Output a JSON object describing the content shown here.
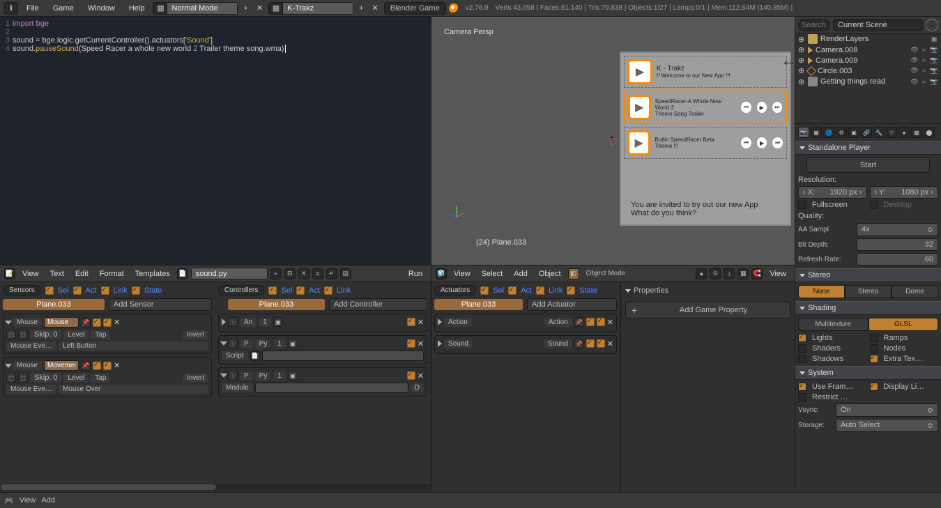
{
  "topbar": {
    "menus": [
      "File",
      "Game",
      "Window",
      "Help"
    ],
    "layout1": {
      "name": "Normal Mode"
    },
    "layout2": {
      "name": "K-Trakz"
    },
    "engine": "Blender Game",
    "version": "v2.76.9",
    "stats": "Verts:43,658 | Faces:61,140 | Tris:79,838 | Objects:1/27 | Lamps:0/1 | Mem:112.64M (140.85M) |"
  },
  "code": {
    "l1": "import bge",
    "l2": "",
    "l3a": "sound = bge.logic.getCurrentController().actuators[",
    "l3b": "'Sound'",
    "l3c": "]",
    "l4": "sound.pauseSound(Speed Racer a whole new world 2 Trailer theme song.wma)"
  },
  "text_header": {
    "menus": [
      "View",
      "Text",
      "Edit",
      "Format",
      "Templates"
    ],
    "filename": "sound.py",
    "run": "Run"
  },
  "viewport": {
    "label": "Camera Persp",
    "object": "(24) Plane.033",
    "phone": {
      "title": "K - Trakz",
      "welcome": "!! Welcome to our New App !!!",
      "row2_t": "SpeedRacer-A Whole New World 2",
      "row2_s": "Theme Song Trailer",
      "row3_t": "Butlin   SpeedRacer Beta Theme !!!",
      "footer1": "You are invited to try out our new App",
      "footer2": "What do you think?"
    }
  },
  "view3d_header": {
    "menus": [
      "View",
      "Select",
      "Add",
      "Object"
    ],
    "mode": "Object Mode"
  },
  "logic": {
    "sensors_hdr": "Sensors",
    "controllers_hdr": "Controllers",
    "actuators_hdr": "Actuators",
    "sel": "Sel",
    "act": "Act",
    "link": "Link",
    "state": "State",
    "object": "Plane.033",
    "add_sensor": "Add Sensor",
    "add_controller": "Add Controller",
    "add_actuator": "Add Actuator",
    "mouse_kind": "Mouse",
    "mouse_name1": "Mouse",
    "mouse_name2": "Movement",
    "skip_lbl": "Skip:",
    "skip_val": "0",
    "level": "Level",
    "tap": "Tap",
    "invert": "Invert",
    "mouse_event_lbl": "Mouse Eve…",
    "left_button": "Left Button",
    "mouse_over": "Mouse Over",
    "and_kind": "An",
    "py_kind": "Py",
    "one": "1",
    "script_lbl": "Script",
    "module_lbl": "Module",
    "action_kind": "Action",
    "action_name": "Action",
    "sound_kind": "Sound",
    "sound_name": "Sound",
    "d": "D"
  },
  "props_inner": {
    "title": "Properties",
    "add_game": "Add Game Property"
  },
  "bottombar": {
    "view": "View",
    "add": "Add"
  },
  "search": {
    "placeholder": "Search",
    "scene": "Current Scene"
  },
  "outliner": {
    "items": [
      {
        "name": "RenderLayers",
        "icon": "scene"
      },
      {
        "name": "Camera.008",
        "icon": "cam"
      },
      {
        "name": "Camera.009",
        "icon": "cam"
      },
      {
        "name": "Circle.003",
        "icon": "mesh"
      },
      {
        "name": "Getting things read",
        "icon": "text"
      }
    ]
  },
  "properties": {
    "standalone_hdr": "Standalone Player",
    "start": "Start",
    "resolution": "Resolution:",
    "res_x_lbl": "X:",
    "res_x": "1920 px",
    "res_y_lbl": "Y:",
    "res_y": "1080 px",
    "fullscreen": "Fullscreen",
    "desktop": "Desktop",
    "quality": "Quality:",
    "aa_lbl": "AA Sampl",
    "aa_val": "4x",
    "bitdepth_lbl": "Bit Depth:",
    "bitdepth": "32",
    "refresh_lbl": "Refresh Rate:",
    "refresh": "60",
    "stereo_hdr": "Stereo",
    "stereo_none": "None",
    "stereo_stereo": "Stereo",
    "stereo_dome": "Dome",
    "shading_hdr": "Shading",
    "multitex": "Multitexture",
    "glsl": "GLSL",
    "lights": "Lights",
    "ramps": "Ramps",
    "shaders": "Shaders",
    "nodes": "Nodes",
    "shadows": "Shadows",
    "extra": "Extra Tex…",
    "system_hdr": "System",
    "use_frame": "Use Fram…",
    "display_li": "Display Li…",
    "restrict": "Restrict …",
    "vsync_lbl": "Vsync:",
    "vsync": "On",
    "storage_lbl": "Storage:",
    "storage": "Auto Select"
  }
}
